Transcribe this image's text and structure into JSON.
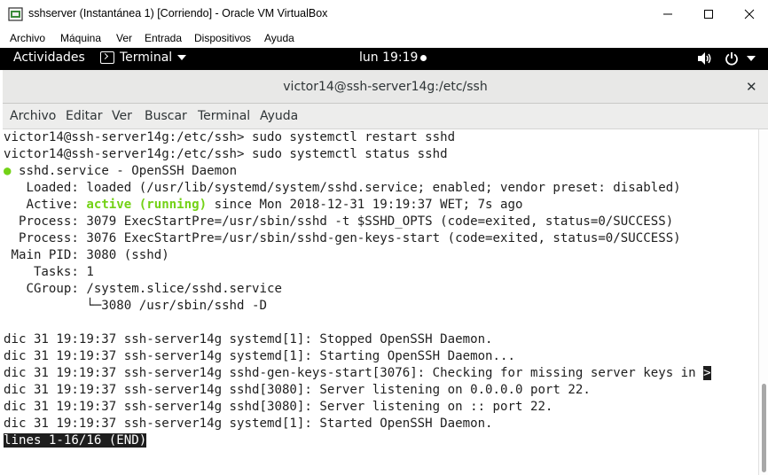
{
  "vbox": {
    "title": "sshserver (Instantánea 1) [Corriendo] - Oracle VM VirtualBox",
    "menu": [
      "Archivo",
      "Máquina",
      "Ver",
      "Entrada",
      "Dispositivos",
      "Ayuda"
    ]
  },
  "gnome": {
    "activities": "Actividades",
    "app_menu": "Terminal",
    "clock": "lun 19:19",
    "icons": [
      "volume-icon",
      "power-icon",
      "chevron-down-icon"
    ]
  },
  "terminal": {
    "title": "victor14@ssh-server14g:/etc/ssh",
    "menu": [
      "Archivo",
      "Editar",
      "Ver",
      "Buscar",
      "Terminal",
      "Ayuda"
    ],
    "lines": {
      "l1": "victor14@ssh-server14g:/etc/ssh> sudo systemctl restart sshd",
      "l2": "victor14@ssh-server14g:/etc/ssh> sudo systemctl status sshd",
      "l3_dot": "●",
      "l3": " sshd.service - OpenSSH Daemon",
      "l4": "   Loaded: loaded (/usr/lib/systemd/system/sshd.service; enabled; vendor preset: disabled)",
      "l5_pre": "   Active: ",
      "l5_status": "active (running)",
      "l5_post": " since Mon 2018-12-31 19:19:37 WET; 7s ago",
      "l6": "  Process: 3079 ExecStartPre=/usr/sbin/sshd -t $SSHD_OPTS (code=exited, status=0/SUCCESS)",
      "l7": "  Process: 3076 ExecStartPre=/usr/sbin/sshd-gen-keys-start (code=exited, status=0/SUCCESS)",
      "l8": " Main PID: 3080 (sshd)",
      "l9": "    Tasks: 1",
      "l10": "   CGroup: /system.slice/sshd.service",
      "l11": "           └─3080 /usr/sbin/sshd -D",
      "l13": "dic 31 19:19:37 ssh-server14g systemd[1]: Stopped OpenSSH Daemon.",
      "l14": "dic 31 19:19:37 ssh-server14g systemd[1]: Starting OpenSSH Daemon...",
      "l15": "dic 31 19:19:37 ssh-server14g sshd-gen-keys-start[3076]: Checking for missing server keys in ",
      "l15_arrow": ">",
      "l16": "dic 31 19:19:37 ssh-server14g sshd[3080]: Server listening on 0.0.0.0 port 22.",
      "l17": "dic 31 19:19:37 ssh-server14g sshd[3080]: Server listening on :: port 22.",
      "l18": "dic 31 19:19:37 ssh-server14g systemd[1]: Started OpenSSH Daemon.",
      "status": "lines 1-16/16 (END)"
    }
  }
}
